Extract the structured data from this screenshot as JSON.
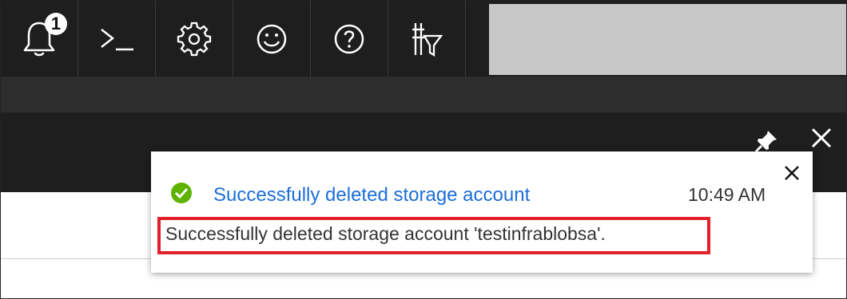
{
  "toolbar": {
    "notification_count": "1",
    "buttons": [
      "bell-icon",
      "cloud-shell-icon",
      "gear-icon",
      "smiley-icon",
      "help-icon",
      "directory-filter-icon"
    ]
  },
  "blade": {
    "pin": "pin-icon",
    "close": "close-icon"
  },
  "notification": {
    "title": "Successfully deleted storage account",
    "time": "10:49 AM",
    "message": "Successfully deleted storage account 'testinfrablobsa'.",
    "status_color": "#5db300",
    "title_color": "#1a6ed8",
    "highlight_color": "#e2202a"
  }
}
